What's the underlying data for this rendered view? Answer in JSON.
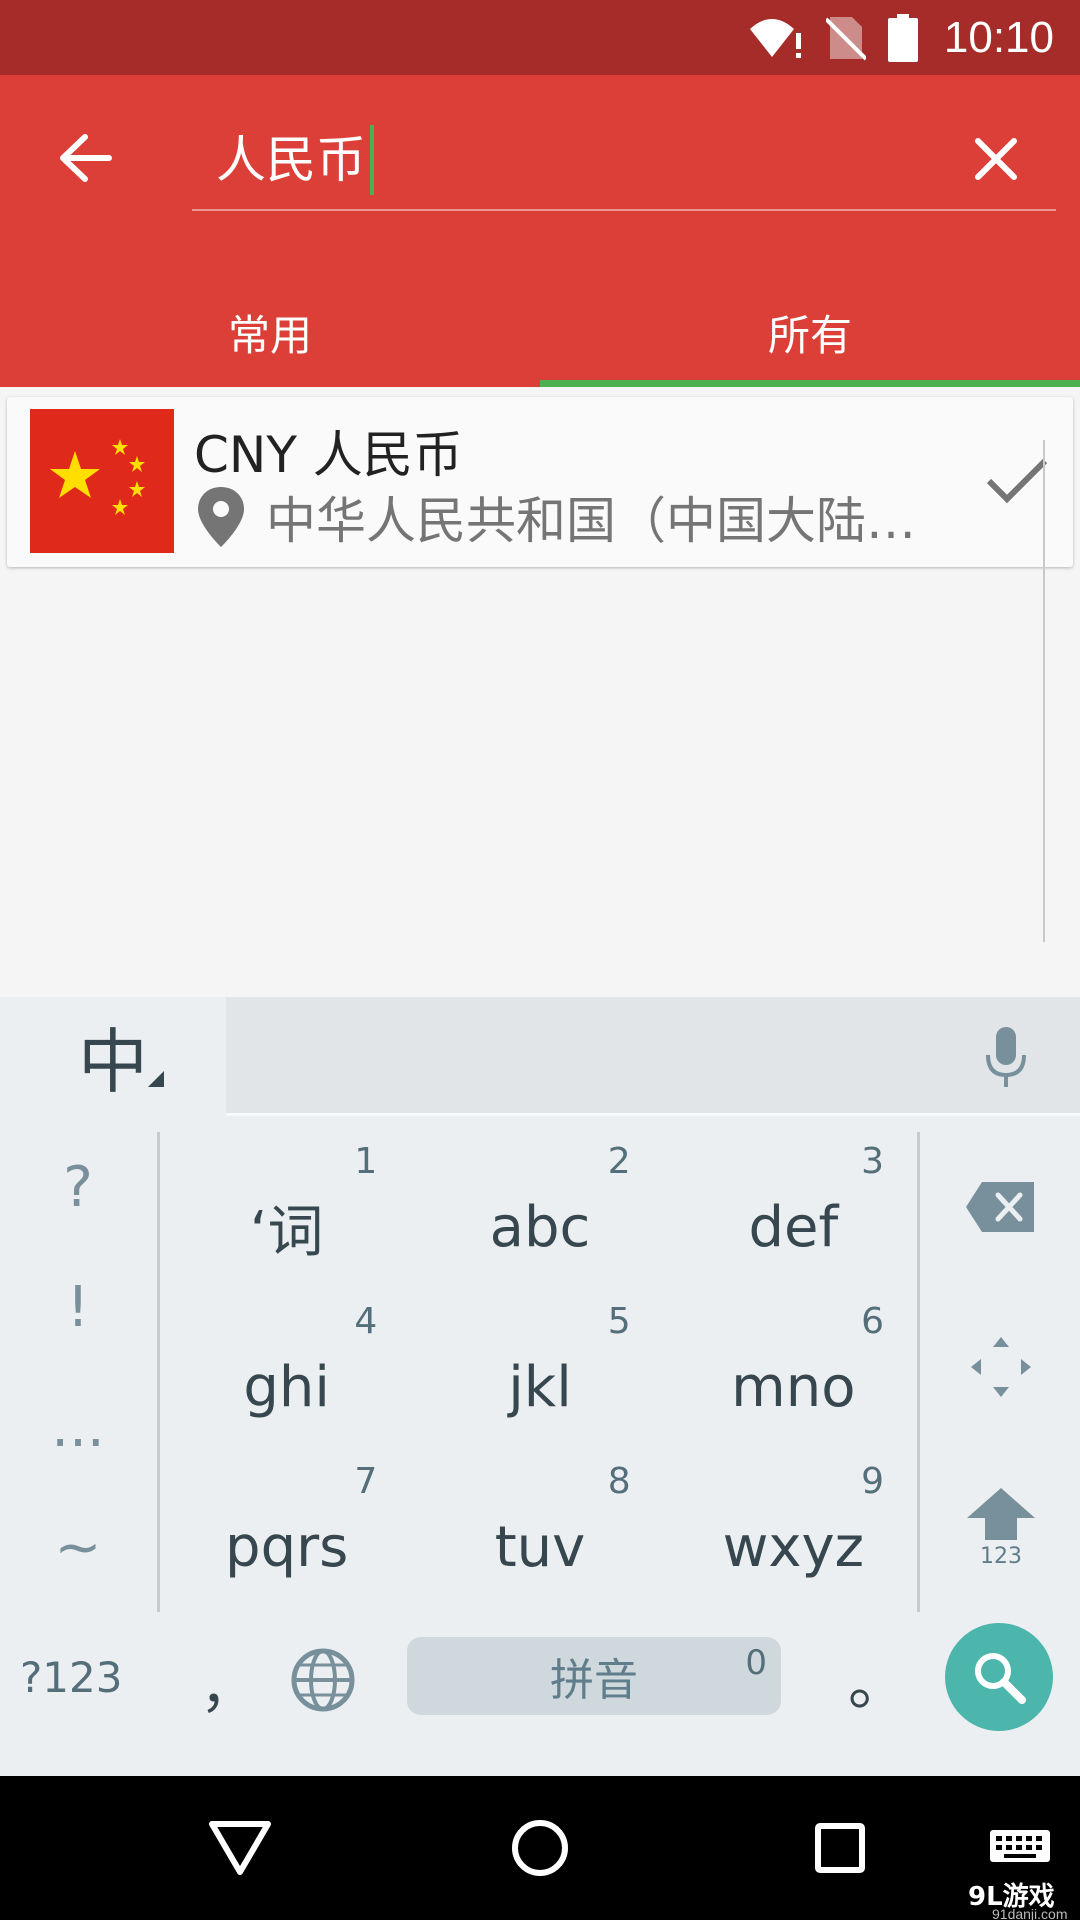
{
  "status_bar": {
    "time": "10:10",
    "icons": [
      "wifi-alert-icon",
      "no-sim-icon",
      "battery-icon"
    ]
  },
  "search": {
    "query": "人民币"
  },
  "tabs": [
    {
      "label": "常用",
      "active": false
    },
    {
      "label": "所有",
      "active": true
    }
  ],
  "results": [
    {
      "title": "CNY 人民币",
      "region": "中华人民共和国（中国大陆…",
      "flag": "china-flag",
      "selected": true
    }
  ],
  "keyboard": {
    "lang_key": "中",
    "left_keys": [
      "?",
      "!",
      "...",
      "~"
    ],
    "keys": [
      {
        "label": "‘词",
        "num": "1"
      },
      {
        "label": "abc",
        "num": "2"
      },
      {
        "label": "def",
        "num": "3"
      },
      {
        "label": "ghi",
        "num": "4"
      },
      {
        "label": "jkl",
        "num": "5"
      },
      {
        "label": "mno",
        "num": "6"
      },
      {
        "label": "pqrs",
        "num": "7"
      },
      {
        "label": "tuv",
        "num": "8"
      },
      {
        "label": "wxyz",
        "num": "9"
      }
    ],
    "shift_label": "123",
    "symbols_key": "?123",
    "comma": "，",
    "space_label": "拼音",
    "space_num": "0",
    "period": "。"
  },
  "watermark": {
    "logo": "9L游戏",
    "url": "91danji.com"
  },
  "colors": {
    "status_bar": "#a52c29",
    "app_bar": "#db3f38",
    "tab_indicator": "#4caf50",
    "search_key": "#4db6ac"
  }
}
